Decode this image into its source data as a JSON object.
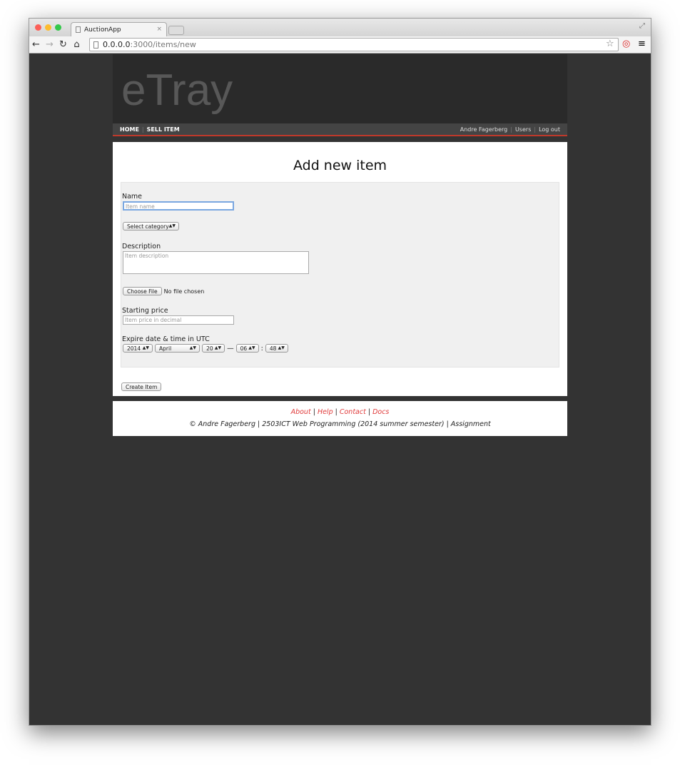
{
  "browser": {
    "tab_title": "AuctionApp",
    "url_host": "0.0.0.0",
    "url_path": ":3000/items/new"
  },
  "site": {
    "logo": "eTray",
    "nav_left": [
      "HOME",
      "SELL ITEM"
    ],
    "user": "Andre Fagerberg",
    "nav_right": [
      "Users",
      "Log out"
    ]
  },
  "form": {
    "title": "Add new item",
    "name_label": "Name",
    "name_placeholder": "Item name",
    "category": "Select category",
    "description_label": "Description",
    "description_placeholder": "Item description",
    "file_button": "Choose File",
    "file_status": "No file chosen",
    "price_label": "Starting price",
    "price_placeholder": "Item price in decimal",
    "expire_label": "Expire date & time in UTC",
    "year": "2014",
    "month": "April",
    "day": "20",
    "dash": "—",
    "hour": "06",
    "colon": ":",
    "minute": "48",
    "submit": "Create Item"
  },
  "footer": {
    "links": [
      "About",
      "Help",
      "Contact",
      "Docs"
    ],
    "credit": "© Andre Fagerberg | 2503ICT Web Programming (2014 summer semester) | Assignment"
  },
  "colors": {
    "accent": "#c0392b",
    "link": "#e03b3b"
  }
}
